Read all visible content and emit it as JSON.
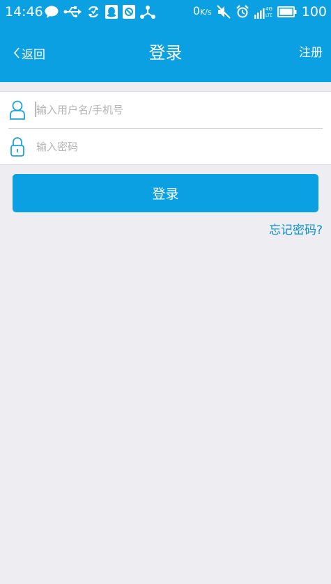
{
  "status_bar": {
    "time": "14:46",
    "net_speed_value": "0",
    "net_speed_unit": "K/s",
    "battery": "100",
    "icons": [
      "chat-bubble-icon",
      "usb-icon",
      "sync-icon",
      "qq-icon",
      "app-icon",
      "share-icon",
      "mute-icon",
      "alarm-icon",
      "signal-4g-icon",
      "battery-icon"
    ]
  },
  "nav": {
    "back_label": "返回",
    "title": "登录",
    "register_label": "注册"
  },
  "form": {
    "username_placeholder": "输入用户名/手机号",
    "password_placeholder": "输入密码"
  },
  "login_button_label": "登录",
  "forgot_password_label": "忘记密码?",
  "colors": {
    "accent": "#0aa0e2",
    "background": "#ededf2",
    "link": "#0b8fc9"
  }
}
